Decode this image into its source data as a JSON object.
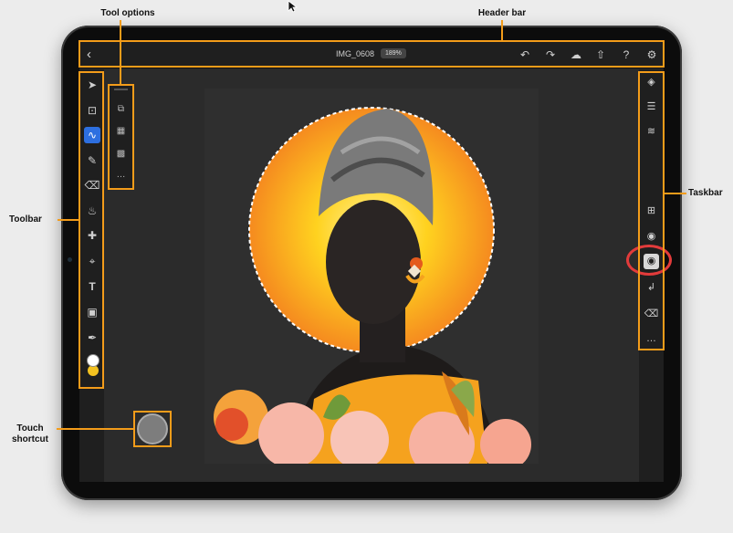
{
  "callouts": {
    "tool_options": "Tool options",
    "header_bar": "Header bar",
    "toolbar": "Toolbar",
    "taskbar": "Taskbar",
    "touch_shortcut": "Touch shortcut"
  },
  "header": {
    "back_icon": "chevron-left-icon",
    "document_name": "IMG_0608",
    "zoom": "189%",
    "icons": [
      "undo-icon",
      "redo-icon",
      "cloud-icon",
      "share-icon",
      "help-icon",
      "gear-icon"
    ]
  },
  "toolbar": {
    "tools": [
      "move-tool-icon",
      "transform-tool-icon",
      "selection-brush-tool-icon",
      "brush-tool-icon",
      "eraser-tool-icon",
      "fill-tool-icon",
      "healing-tool-icon",
      "crop-tool-icon",
      "type-tool-icon",
      "place-image-tool-icon",
      "eyedropper-tool-icon",
      "color-picker-icon"
    ],
    "active_tool": "selection-brush-tool-icon"
  },
  "tool_options": {
    "icons": [
      "add-selection-icon",
      "subtract-selection-icon",
      "intersect-selection-icon",
      "more-options-icon"
    ]
  },
  "taskbar": {
    "icons": [
      "layers-icon",
      "layer-properties-icon",
      "adjustments-icon",
      "add-layer-icon",
      "visibility-icon",
      "mask-icon",
      "clip-layer-icon",
      "eraser-mask-icon",
      "more-icon"
    ],
    "highlighted": "mask-icon"
  },
  "colors": {
    "callout": "#f39c1a",
    "highlight_circle": "#e23b3b",
    "active_tool": "#2d6fe0",
    "sun_yellow": "#ffd21f",
    "sun_orange": "#f58a1f"
  }
}
